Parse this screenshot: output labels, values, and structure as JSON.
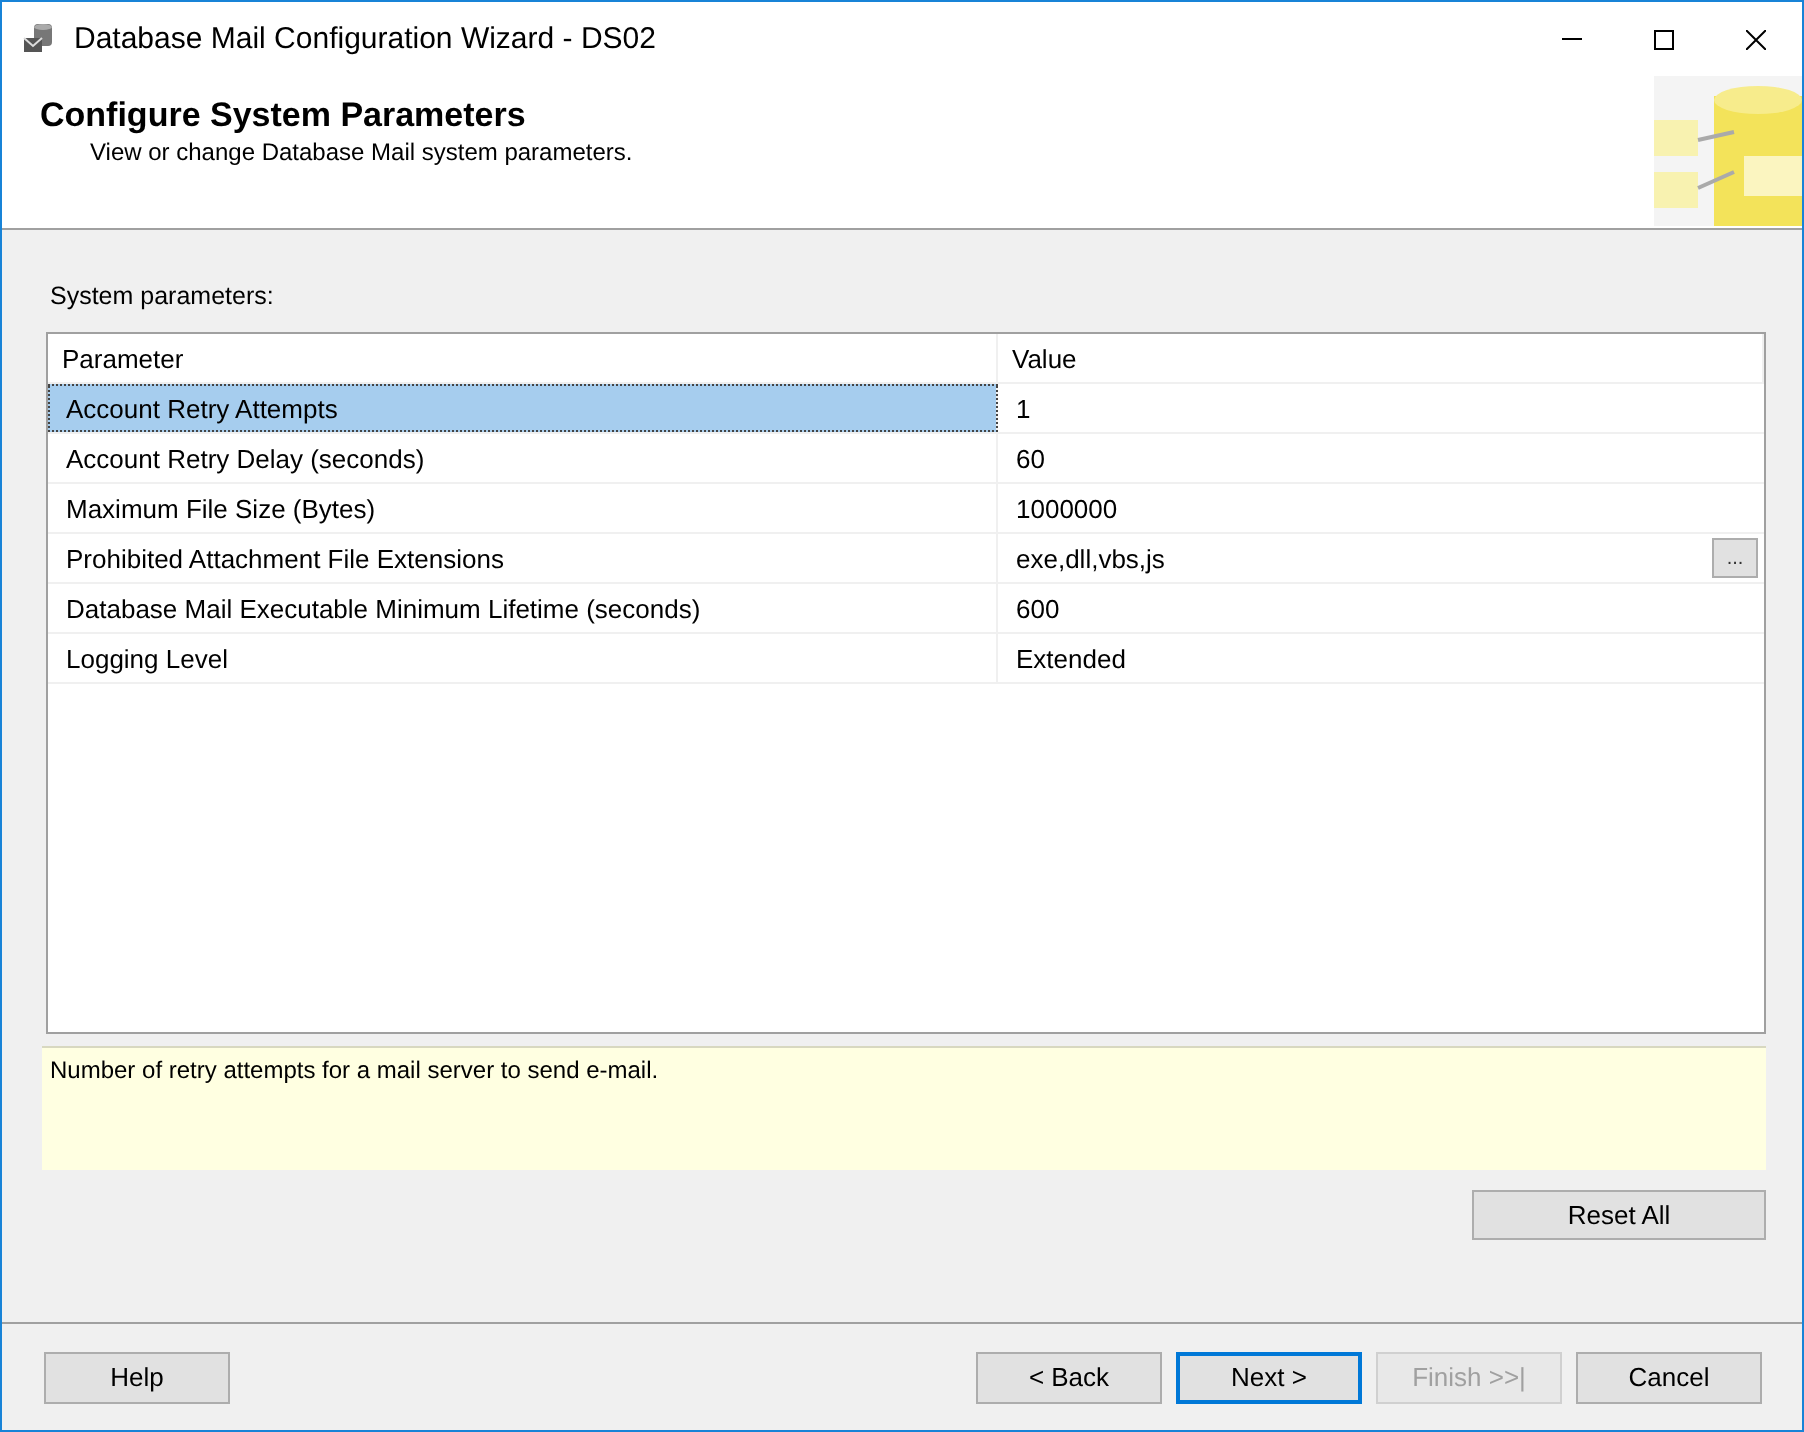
{
  "window": {
    "title": "Database Mail Configuration Wizard - DS02"
  },
  "header": {
    "title": "Configure System Parameters",
    "subtitle": "View or change Database Mail system parameters."
  },
  "grid_label": "System parameters:",
  "table": {
    "columns": [
      "Parameter",
      "Value"
    ],
    "rows": [
      {
        "parameter": "Account Retry Attempts",
        "value": "1",
        "selected": true
      },
      {
        "parameter": "Account Retry Delay (seconds)",
        "value": "60",
        "selected": false
      },
      {
        "parameter": "Maximum File Size (Bytes)",
        "value": "1000000",
        "selected": false
      },
      {
        "parameter": "Prohibited Attachment File Extensions",
        "value": "exe,dll,vbs,js",
        "selected": false,
        "browse": "..."
      },
      {
        "parameter": "Database Mail Executable Minimum Lifetime (seconds)",
        "value": "600",
        "selected": false
      },
      {
        "parameter": "Logging Level",
        "value": "Extended",
        "selected": false
      }
    ]
  },
  "description": "Number of retry attempts for a mail server to send e-mail.",
  "reset_button": {
    "label": "Reset All"
  },
  "footer": {
    "left_buttons": [
      {
        "label": "Help",
        "disabled": false,
        "default": false
      }
    ],
    "right_buttons": [
      {
        "label": "< Back",
        "disabled": false,
        "default": false
      },
      {
        "label": "Next >",
        "disabled": false,
        "default": true
      },
      {
        "label": "Finish >>|",
        "disabled": true,
        "default": false
      },
      {
        "label": "Cancel",
        "disabled": false,
        "default": false
      }
    ]
  }
}
